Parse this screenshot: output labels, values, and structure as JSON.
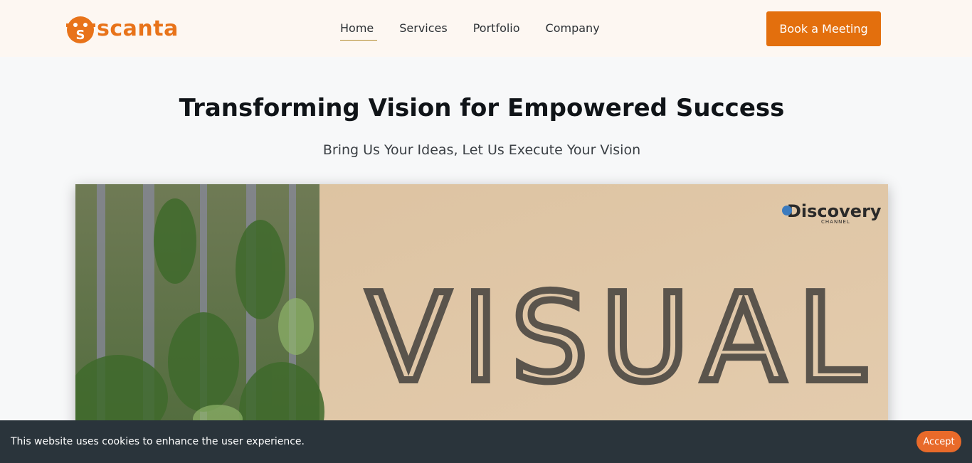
{
  "brand": {
    "name": "scanta",
    "accent": "#e8731a"
  },
  "nav": {
    "items": [
      {
        "label": "Home",
        "active": true
      },
      {
        "label": "Services"
      },
      {
        "label": "Portfolio"
      },
      {
        "label": "Company"
      }
    ]
  },
  "header": {
    "cta_label": "Book a Meeting"
  },
  "hero": {
    "title": "Transforming Vision for Empowered Success",
    "subtitle": "Bring Us Your Ideas, Let Us Execute Your Vision"
  },
  "media": {
    "sign_text": "VISUAL",
    "watermark": "Discovery",
    "watermark_sub": "CHANNEL"
  },
  "cookie": {
    "message": "This website uses cookies to enhance the user experience.",
    "accept_label": "Accept"
  }
}
